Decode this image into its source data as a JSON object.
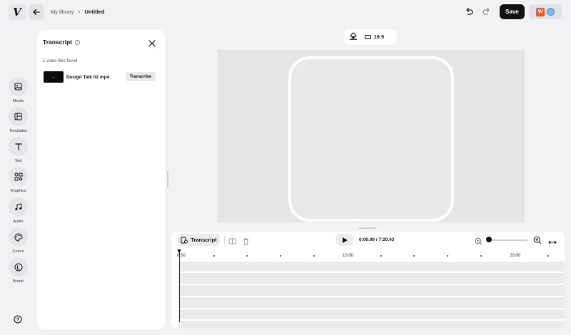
{
  "topbar": {
    "logo": "V",
    "breadcrumb": {
      "library": "My library",
      "separator": "›",
      "current": "Untitled"
    },
    "save_label": "Save",
    "brand_chip_letter": "W"
  },
  "rail": [
    {
      "label": "Media",
      "icon": "image-icon"
    },
    {
      "label": "Templates",
      "icon": "template-icon"
    },
    {
      "label": "Text",
      "icon": "text-icon"
    },
    {
      "label": "Graphics",
      "icon": "shapes-icon"
    },
    {
      "label": "Audio",
      "icon": "music-note-icon"
    },
    {
      "label": "Colors",
      "icon": "palette-icon"
    },
    {
      "label": "Brand",
      "icon": "brand-icon"
    }
  ],
  "help_label": "?",
  "transcript_panel": {
    "title": "Transcript",
    "info": "i",
    "found_text": "1 video files found",
    "file_name": "Design Talk 02.mp4",
    "transcribe_label": "Transcribe"
  },
  "canvas_toolbar": {
    "aspect_ratio": "16:9"
  },
  "timeline": {
    "transcript_label": "Transcript",
    "timecode": "0:00.00 / 7:20.43",
    "zoom_level": 0,
    "ruler_labels": [
      "0:00",
      "10:00",
      "20:00"
    ]
  },
  "colors": {
    "accent": "#111111",
    "brand_orange": "#f25c1f",
    "background": "#f2f2f4"
  }
}
